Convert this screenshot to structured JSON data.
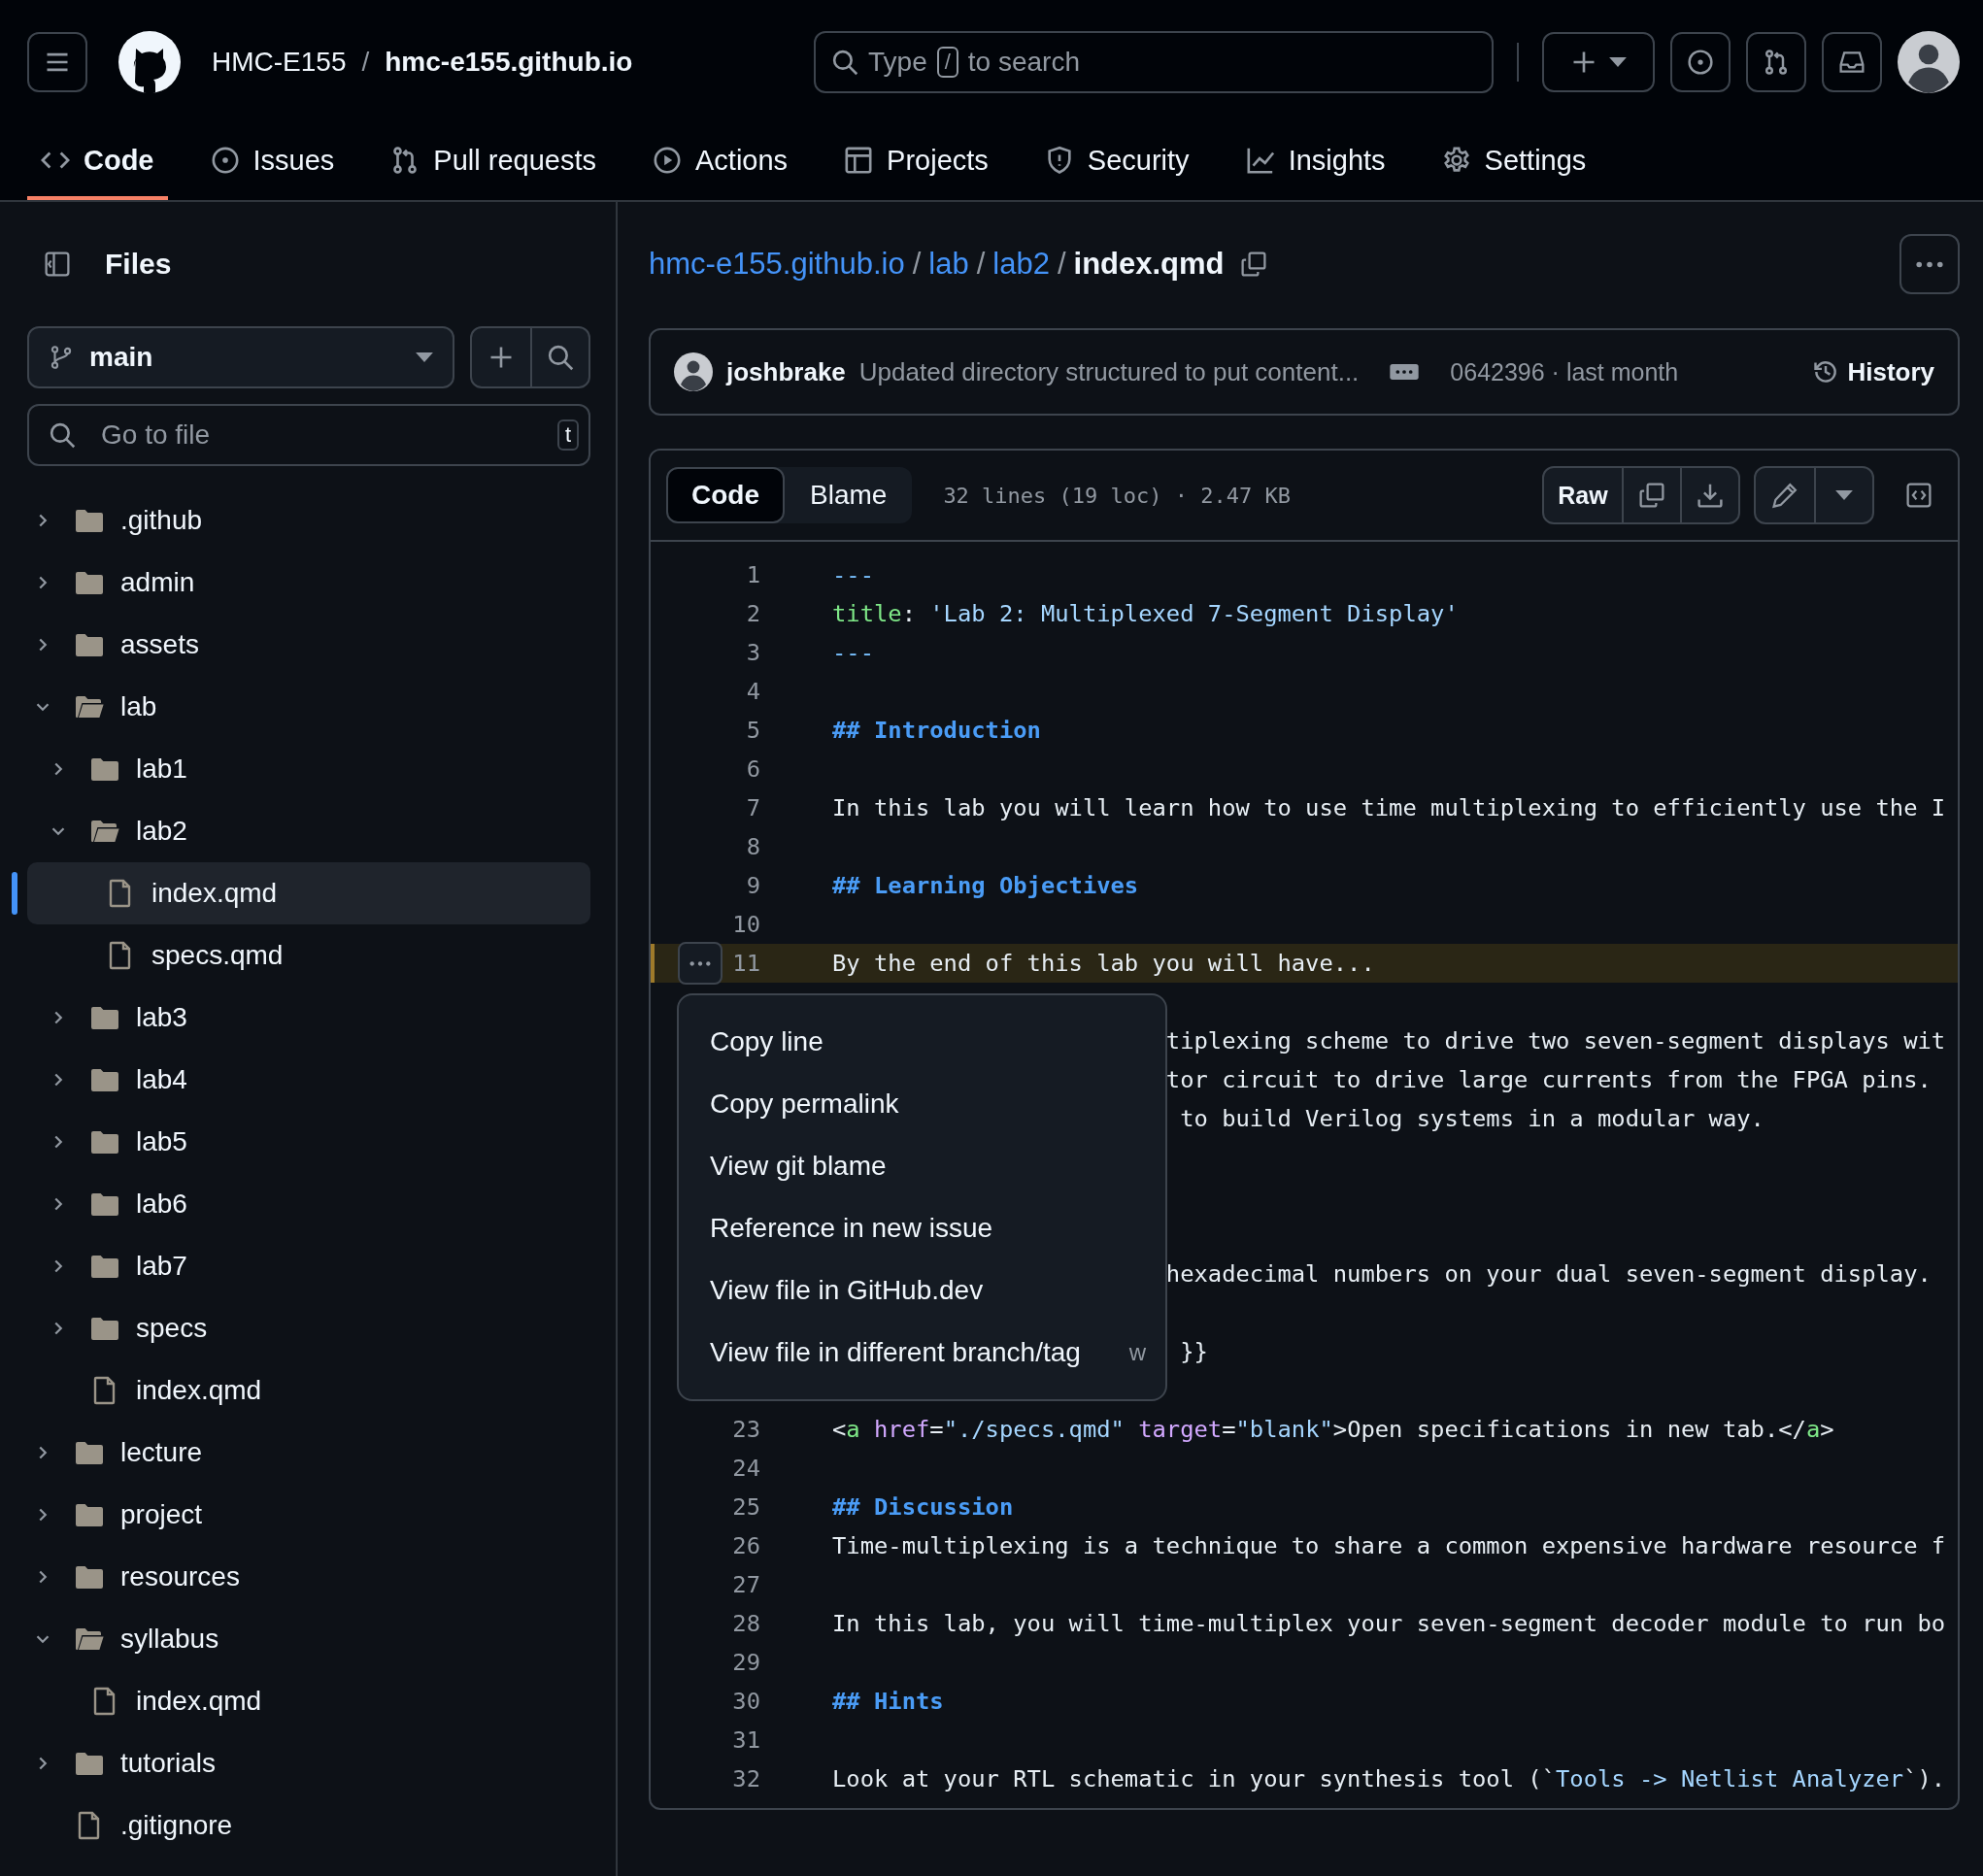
{
  "header": {
    "owner": "HMC-E155",
    "separator": "/",
    "repo": "hmc-e155.github.io",
    "search": {
      "prefix": "Type",
      "key": "/",
      "suffix": "to search"
    }
  },
  "repo_tabs": [
    {
      "label": "Code",
      "selected": true
    },
    {
      "label": "Issues",
      "selected": false
    },
    {
      "label": "Pull requests",
      "selected": false
    },
    {
      "label": "Actions",
      "selected": false
    },
    {
      "label": "Projects",
      "selected": false
    },
    {
      "label": "Security",
      "selected": false
    },
    {
      "label": "Insights",
      "selected": false
    },
    {
      "label": "Settings",
      "selected": false
    }
  ],
  "sidebar": {
    "title": "Files",
    "branch": "main",
    "go_to_file": {
      "placeholder": "Go to file",
      "shortcut": "t"
    },
    "tree": [
      {
        "name": ".github",
        "kind": "folder",
        "expanded": false,
        "selected": false
      },
      {
        "name": "admin",
        "kind": "folder",
        "expanded": false,
        "selected": false
      },
      {
        "name": "assets",
        "kind": "folder",
        "expanded": false,
        "selected": false
      },
      {
        "name": "lab",
        "kind": "folder",
        "expanded": true,
        "selected": false,
        "children": [
          {
            "name": "lab1",
            "kind": "folder",
            "expanded": false,
            "selected": false
          },
          {
            "name": "lab2",
            "kind": "folder",
            "expanded": true,
            "selected": false,
            "children": [
              {
                "name": "index.qmd",
                "kind": "file",
                "selected": true
              },
              {
                "name": "specs.qmd",
                "kind": "file",
                "selected": false
              }
            ]
          },
          {
            "name": "lab3",
            "kind": "folder",
            "expanded": false,
            "selected": false
          },
          {
            "name": "lab4",
            "kind": "folder",
            "expanded": false,
            "selected": false
          },
          {
            "name": "lab5",
            "kind": "folder",
            "expanded": false,
            "selected": false
          },
          {
            "name": "lab6",
            "kind": "folder",
            "expanded": false,
            "selected": false
          },
          {
            "name": "lab7",
            "kind": "folder",
            "expanded": false,
            "selected": false
          },
          {
            "name": "specs",
            "kind": "folder",
            "expanded": false,
            "selected": false
          },
          {
            "name": "index.qmd",
            "kind": "file",
            "selected": false
          }
        ]
      },
      {
        "name": "lecture",
        "kind": "folder",
        "expanded": false,
        "selected": false
      },
      {
        "name": "project",
        "kind": "folder",
        "expanded": false,
        "selected": false
      },
      {
        "name": "resources",
        "kind": "folder",
        "expanded": false,
        "selected": false
      },
      {
        "name": "syllabus",
        "kind": "folder",
        "expanded": true,
        "selected": false,
        "children": [
          {
            "name": "index.qmd",
            "kind": "file",
            "selected": false
          }
        ]
      },
      {
        "name": "tutorials",
        "kind": "folder",
        "expanded": false,
        "selected": false
      },
      {
        "name": ".gitignore",
        "kind": "file",
        "selected": false
      }
    ]
  },
  "breadcrumb": {
    "crumbs": [
      {
        "label": "hmc-e155.github.io",
        "separator": "/"
      },
      {
        "label": "lab",
        "separator": "/"
      },
      {
        "label": "lab2",
        "separator": "/"
      }
    ],
    "file": "index.qmd"
  },
  "commit": {
    "author": "joshbrake",
    "message": "Updated directory structured to put content...",
    "meta": "0642396 · last month",
    "history": "History"
  },
  "file_view": {
    "modes": [
      {
        "label": "Code",
        "selected": true
      },
      {
        "label": "Blame",
        "selected": false
      }
    ],
    "info": "32 lines (19 loc) · 2.47 KB",
    "raw": "Raw",
    "lines": [
      {
        "kind": "line",
        "number": "1",
        "active": false,
        "tokens": [
          {
            "text": "---",
            "kind": "punct"
          }
        ]
      },
      {
        "kind": "line",
        "number": "2",
        "active": false,
        "tokens": [
          {
            "text": "title",
            "kind": "key"
          },
          {
            "text": ": ",
            "kind": "plain"
          },
          {
            "text": "'Lab 2: Multiplexed 7-Segment Display'",
            "kind": "string"
          }
        ]
      },
      {
        "kind": "line",
        "number": "3",
        "active": false,
        "tokens": [
          {
            "text": "---",
            "kind": "punct"
          }
        ]
      },
      {
        "kind": "line",
        "number": "4",
        "active": false
      },
      {
        "kind": "line",
        "number": "5",
        "active": false,
        "tokens": [
          {
            "text": "## Introduction",
            "kind": "heading"
          }
        ]
      },
      {
        "kind": "line",
        "number": "6",
        "active": false
      },
      {
        "kind": "line",
        "number": "7",
        "active": false,
        "tokens": [
          {
            "text": "In this lab you will learn how to use time multiplexing to efficiently use the I",
            "kind": "plain"
          }
        ]
      },
      {
        "kind": "line",
        "number": "8",
        "active": false
      },
      {
        "kind": "line",
        "number": "9",
        "active": false,
        "tokens": [
          {
            "text": "## Learning Objectives",
            "kind": "heading"
          }
        ]
      },
      {
        "kind": "line",
        "number": "10",
        "active": false
      },
      {
        "kind": "line",
        "number": "11",
        "active": true,
        "tokens": [
          {
            "text": "By the end of this lab you will have...",
            "kind": "plain"
          }
        ]
      },
      {
        "kind": "covered"
      },
      {
        "kind": "covered",
        "tokens": [
          {
            "text": "tiplexing scheme to drive two seven-segment displays wit",
            "kind": "plain"
          }
        ]
      },
      {
        "kind": "covered",
        "tokens": [
          {
            "text": "tor circuit to drive large currents from the FPGA pins.",
            "kind": "plain"
          }
        ]
      },
      {
        "kind": "covered",
        "tokens": [
          {
            "text": " to build Verilog systems in a modular way.",
            "kind": "plain"
          }
        ]
      },
      {
        "kind": "covered"
      },
      {
        "kind": "covered"
      },
      {
        "kind": "covered"
      },
      {
        "kind": "covered",
        "tokens": [
          {
            "text": "hexadecimal numbers on your dual seven-segment display.",
            "kind": "plain"
          }
        ]
      },
      {
        "kind": "covered"
      },
      {
        "kind": "covered",
        "tokens": [
          {
            "text": " }}",
            "kind": "plain"
          }
        ]
      },
      {
        "kind": "covered"
      },
      {
        "kind": "line",
        "number": "23",
        "active": false,
        "tokens": [
          {
            "text": "<",
            "kind": "plain"
          },
          {
            "text": "a",
            "kind": "tag"
          },
          {
            "text": " href",
            "kind": "attr"
          },
          {
            "text": "=",
            "kind": "plain"
          },
          {
            "text": "\"./specs.qmd\"",
            "kind": "string"
          },
          {
            "text": " target",
            "kind": "attr"
          },
          {
            "text": "=",
            "kind": "plain"
          },
          {
            "text": "\"blank\"",
            "kind": "string"
          },
          {
            "text": ">Open specifications in new tab.</",
            "kind": "plain"
          },
          {
            "text": "a",
            "kind": "tag"
          },
          {
            "text": ">",
            "kind": "plain"
          }
        ]
      },
      {
        "kind": "line",
        "number": "24",
        "active": false
      },
      {
        "kind": "line",
        "number": "25",
        "active": false,
        "tokens": [
          {
            "text": "## Discussion",
            "kind": "heading"
          }
        ]
      },
      {
        "kind": "line",
        "number": "26",
        "active": false,
        "tokens": [
          {
            "text": "Time-multiplexing is a technique to share a common expensive hardware resource f",
            "kind": "plain"
          }
        ]
      },
      {
        "kind": "line",
        "number": "27",
        "active": false
      },
      {
        "kind": "line",
        "number": "28",
        "active": false,
        "tokens": [
          {
            "text": "In this lab, you will time-multiplex your seven-segment decoder module to run bo",
            "kind": "plain"
          }
        ]
      },
      {
        "kind": "line",
        "number": "29",
        "active": false
      },
      {
        "kind": "line",
        "number": "30",
        "active": false,
        "tokens": [
          {
            "text": "## Hints",
            "kind": "heading"
          }
        ]
      },
      {
        "kind": "line",
        "number": "31",
        "active": false
      },
      {
        "kind": "line",
        "number": "32",
        "active": false,
        "tokens": [
          {
            "text": "Look at your RTL schematic in your synthesis tool (`",
            "kind": "plain"
          },
          {
            "text": "Tools -> Netlist Analyzer",
            "kind": "string"
          },
          {
            "text": "`).",
            "kind": "plain"
          }
        ]
      }
    ],
    "context_menu": [
      {
        "label": "Copy line"
      },
      {
        "label": "Copy permalink"
      },
      {
        "label": "View git blame"
      },
      {
        "label": "Reference in new issue"
      },
      {
        "label": "View file in GitHub.dev"
      },
      {
        "label": "View file in different branch/tag",
        "shortcut": "w"
      }
    ]
  }
}
